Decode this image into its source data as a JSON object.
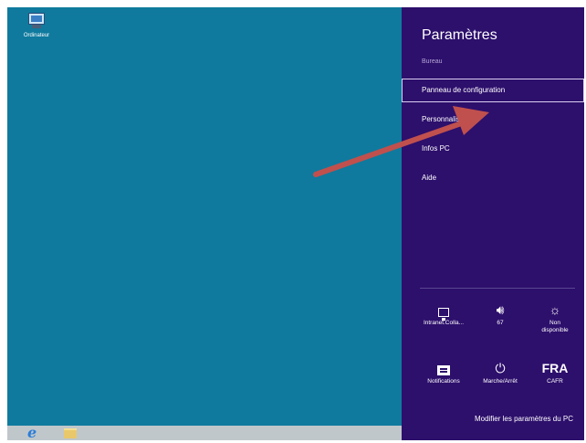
{
  "desktop": {
    "icon_label": "Ordinateur"
  },
  "taskbar": {
    "ie_icon": "internet-explorer-icon",
    "explorer_icon": "file-explorer-icon"
  },
  "charm": {
    "title": "Paramètres",
    "subtitle": "Bureau",
    "items": [
      {
        "label": "Panneau de configuration"
      },
      {
        "label": "Personnalisation"
      },
      {
        "label": "Infos PC"
      },
      {
        "label": "Aide"
      }
    ],
    "quick_settings": [
      {
        "icon": "network-icon",
        "label": "Intranet.Colla..."
      },
      {
        "icon": "volume-icon",
        "label": "67"
      },
      {
        "icon": "brightness-icon",
        "label": "Non disponible"
      },
      {
        "icon": "notifications-icon",
        "label": "Notifications"
      },
      {
        "icon": "power-icon",
        "label": "Marche/Arrêt"
      },
      {
        "icon": "keyboard-icon",
        "icon_text": "FRA",
        "label": "CAFR"
      }
    ],
    "bottom_link": "Modifier les paramètres du PC"
  },
  "colors": {
    "desktop_bg": "#0f7a9e",
    "charm_bg": "#2d0f6c",
    "arrow": "#c0504d"
  }
}
